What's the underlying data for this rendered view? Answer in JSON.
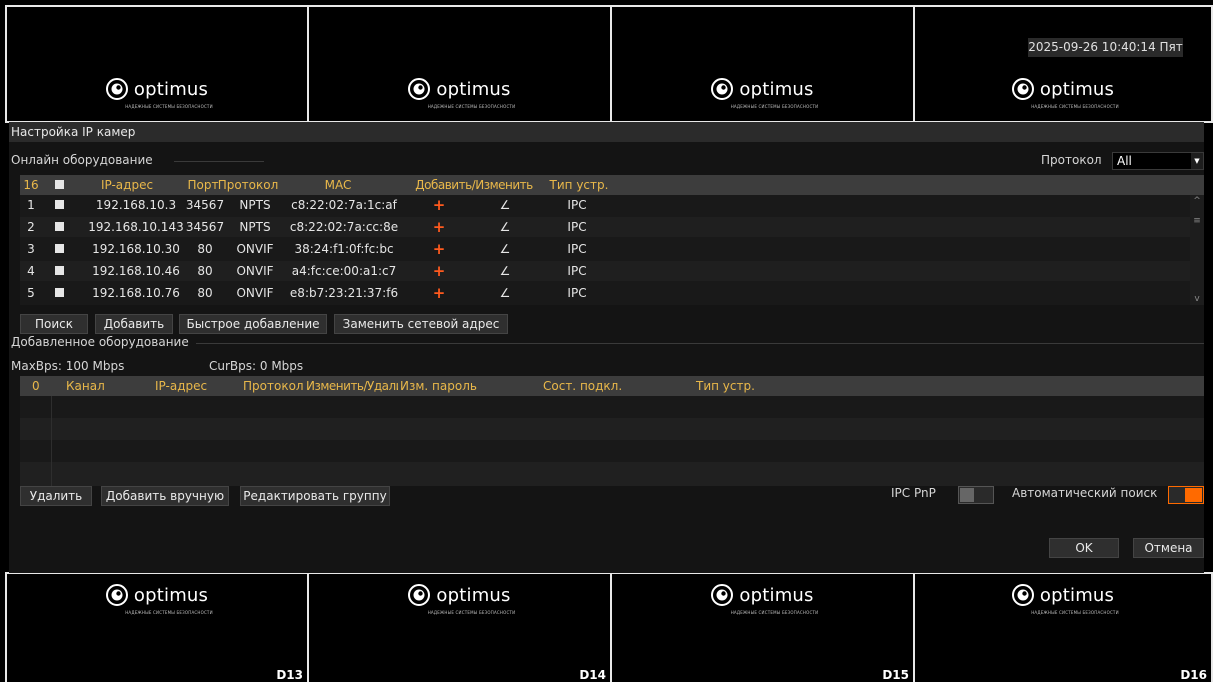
{
  "camera_logo": {
    "name": "optimus",
    "tagline": "НАДЕЖНЫЕ СИСТЕМЫ БЕЗОПАСНОСТИ"
  },
  "datetime": "2025-09-26 10:40:14 Пят",
  "channels": {
    "d13": "D13",
    "d14": "D14",
    "d15": "D15",
    "d16": "D16"
  },
  "dialog": {
    "title": "Настройка IP камер",
    "online_section": "Онлайн оборудование",
    "protocol_label": "Протокол",
    "protocol_value": "All",
    "online_table": {
      "headers": {
        "count": "16",
        "ip": "IP-адрес",
        "port": "Порт",
        "protocol": "Протокол",
        "mac": "MAC",
        "add_edit": "Добавить/Изменить",
        "type": "Тип устр."
      },
      "rows": [
        {
          "num": "1",
          "ip": "192.168.10.3",
          "port": "34567",
          "protocol": "NPTS",
          "mac": "c8:22:02:7a:1c:af",
          "type": "IPC"
        },
        {
          "num": "2",
          "ip": "192.168.10.143",
          "port": "34567",
          "protocol": "NPTS",
          "mac": "c8:22:02:7a:cc:8e",
          "type": "IPC"
        },
        {
          "num": "3",
          "ip": "192.168.10.30",
          "port": "80",
          "protocol": "ONVIF",
          "mac": "38:24:f1:0f:fc:bc",
          "type": "IPC"
        },
        {
          "num": "4",
          "ip": "192.168.10.46",
          "port": "80",
          "protocol": "ONVIF",
          "mac": "a4:fc:ce:00:a1:c7",
          "type": "IPC"
        },
        {
          "num": "5",
          "ip": "192.168.10.76",
          "port": "80",
          "protocol": "ONVIF",
          "mac": "e8:b7:23:21:37:f6",
          "type": "IPC"
        }
      ]
    },
    "online_buttons": {
      "search": "Поиск",
      "add": "Добавить",
      "quick_add": "Быстрое добавление",
      "replace_addr": "Заменить сетевой адрес"
    },
    "added_section": "Добавленное оборудование",
    "max_bps": "MaxBps: 100 Mbps",
    "cur_bps": "CurBps: 0 Mbps",
    "added_table": {
      "headers": {
        "count": "0",
        "channel": "Канал",
        "ip": "IP-адрес",
        "protocol": "Протокол",
        "edit_delete": "Изменить/Удалить",
        "change_password": "Изм. пароль",
        "conn_state": "Сост. подкл.",
        "type": "Тип устр."
      }
    },
    "added_buttons": {
      "delete": "Удалить",
      "add_manual": "Добавить вручную",
      "edit_group": "Редактировать группу"
    },
    "ipc_pnp_label": "IPC PnP",
    "auto_search_label": "Автоматический поиск",
    "ipc_pnp_on": false,
    "auto_search_on": true,
    "ok": "OK",
    "cancel": "Отмена"
  },
  "colors": {
    "accent": "#ff6a00",
    "header_text": "#e9b84a",
    "plus": "#ff5a1e"
  }
}
